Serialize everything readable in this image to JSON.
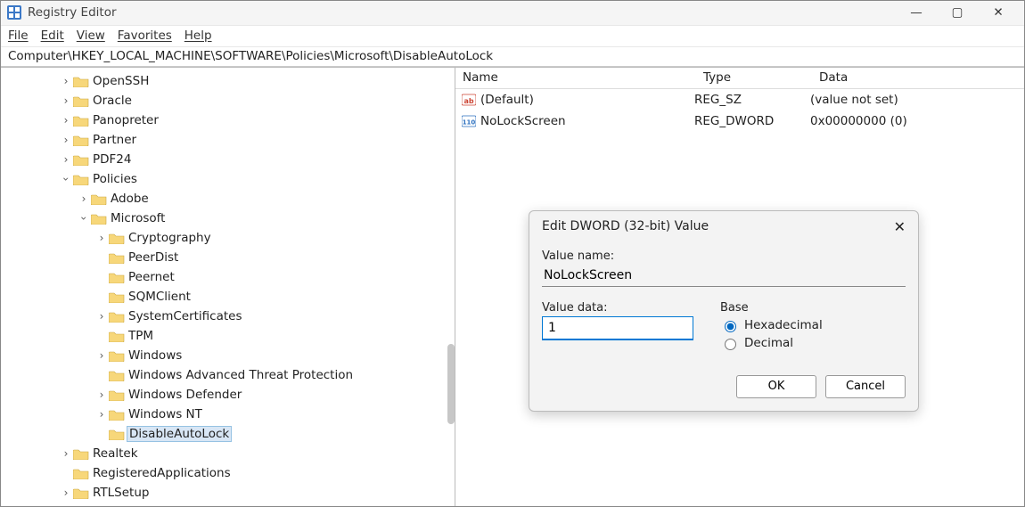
{
  "title": "Registry Editor",
  "menu": {
    "file": "File",
    "edit": "Edit",
    "view": "View",
    "favorites": "Favorites",
    "help": "Help"
  },
  "address": "Computer\\HKEY_LOCAL_MACHINE\\SOFTWARE\\Policies\\Microsoft\\DisableAutoLock",
  "tree": {
    "n0": "OpenSSH",
    "n1": "Oracle",
    "n2": "Panopreter",
    "n3": "Partner",
    "n4": "PDF24",
    "n5": "Policies",
    "n5a": "Adobe",
    "n5b": "Microsoft",
    "c0": "Cryptography",
    "c1": "PeerDist",
    "c2": "Peernet",
    "c3": "SQMClient",
    "c4": "SystemCertificates",
    "c5": "TPM",
    "c6": "Windows",
    "c7": "Windows Advanced Threat Protection",
    "c8": "Windows Defender",
    "c9": "Windows NT",
    "c10": "DisableAutoLock",
    "n6": "Realtek",
    "n7": "RegisteredApplications",
    "n8": "RTLSetup"
  },
  "columns": {
    "name": "Name",
    "type": "Type",
    "data": "Data"
  },
  "rows": [
    {
      "name": "(Default)",
      "type": "REG_SZ",
      "data": "(value not set)"
    },
    {
      "name": "NoLockScreen",
      "type": "REG_DWORD",
      "data": "0x00000000 (0)"
    }
  ],
  "dialog": {
    "title": "Edit DWORD (32-bit) Value",
    "value_name_label": "Value name:",
    "value_name": "NoLockScreen",
    "value_data_label": "Value data:",
    "value_data": "1",
    "base_label": "Base",
    "hex": "Hexadecimal",
    "dec": "Decimal",
    "ok": "OK",
    "cancel": "Cancel"
  }
}
